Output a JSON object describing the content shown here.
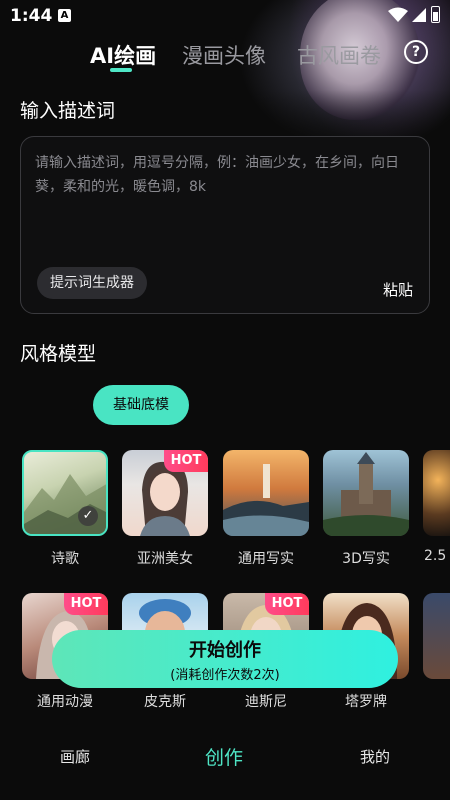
{
  "status_bar": {
    "time": "1:44",
    "notification_icon": "A"
  },
  "tabs": [
    {
      "label": "AI绘画",
      "active": true
    },
    {
      "label": "漫画头像",
      "active": false
    },
    {
      "label": "古风画卷",
      "active": false
    }
  ],
  "help_icon": "?",
  "description": {
    "title": "输入描述词",
    "placeholder": "请输入描述词，用逗号分隔，例：油画少女，在乡间，向日葵，柔和的光，暖色调，8k",
    "prompt_generator_label": "提示词生成器",
    "paste_label": "粘贴"
  },
  "style_model": {
    "title": "风格模型",
    "base_model_label": "基础底模",
    "row1": [
      {
        "label": "诗歌",
        "hot": false,
        "selected": true
      },
      {
        "label": "亚洲美女",
        "hot": true,
        "selected": false
      },
      {
        "label": "通用写实",
        "hot": false,
        "selected": false
      },
      {
        "label": "3D写实",
        "hot": false,
        "selected": false
      },
      {
        "label": "2.5",
        "hot": false,
        "selected": false
      }
    ],
    "row2": [
      {
        "label": "通用动漫",
        "hot": true
      },
      {
        "label": "皮克斯",
        "hot": false
      },
      {
        "label": "迪斯尼",
        "hot": true
      },
      {
        "label": "塔罗牌",
        "hot": false
      },
      {
        "label": "",
        "hot": false
      }
    ],
    "hot_label": "HOT"
  },
  "start_button": {
    "label": "开始创作",
    "sub_label": "(消耗创作次数2次)"
  },
  "bottom_nav": [
    {
      "label": "画廊",
      "active": false
    },
    {
      "label": "创作",
      "active": true
    },
    {
      "label": "我的",
      "active": false
    }
  ],
  "colors": {
    "accent": "#49e4c3",
    "hot": "#ff3b5c",
    "background": "#0b0b0b"
  }
}
